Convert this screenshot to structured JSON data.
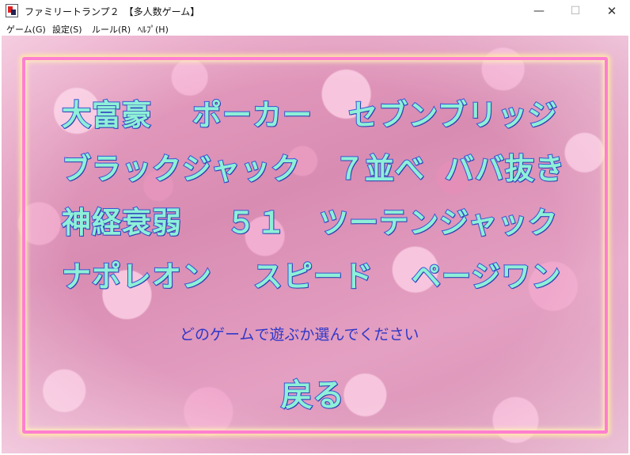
{
  "window": {
    "title": "ファミリートランプ２　【多人数ゲーム】",
    "min_glyph": "—",
    "max_glyph": "☐",
    "close_glyph": "✕"
  },
  "menubar": {
    "items": [
      "ゲーム(G)",
      "設定(S)",
      "ルール(R)",
      "ﾍﾙﾌﾟ(H)"
    ]
  },
  "game_menu": {
    "rows": [
      [
        "大富豪",
        "ポーカー",
        "セブンブリッジ"
      ],
      [
        "ブラックジャック",
        "７並べ",
        "ババ抜き"
      ],
      [
        "神経衰弱",
        "５１",
        "ツーテンジャック"
      ],
      [
        "ナポレオン",
        "スピード",
        "ページワン"
      ]
    ],
    "prompt": "どのゲームで遊ぶか選んでください",
    "back_label": "戻る"
  },
  "colors": {
    "label_fill": "#8ef0d8",
    "label_outline": "#3a52d6",
    "prompt_text": "#3038c8",
    "frame": "#ff7fd0"
  }
}
